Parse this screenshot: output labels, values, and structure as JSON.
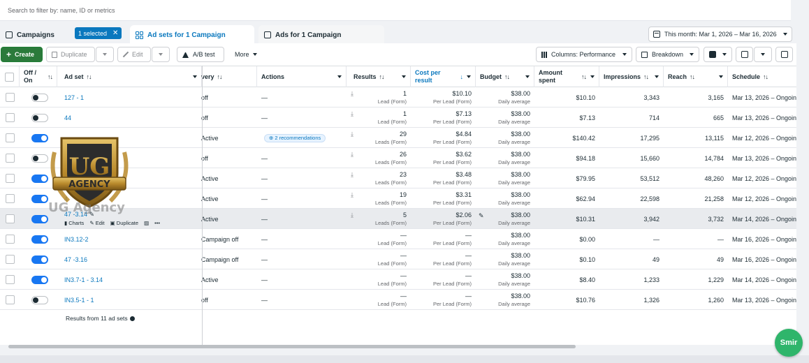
{
  "search": {
    "placeholder": "Search to filter by: name, ID or metrics"
  },
  "tabs": {
    "campaigns": "Campaigns",
    "selected_chip": "1 selected",
    "adsets": "Ad sets for 1 Campaign",
    "ads": "Ads for 1 Campaign"
  },
  "date_range": "This month: Mar 1, 2026 – Mar 16, 2026",
  "toolbar": {
    "create": "Create",
    "duplicate": "Duplicate",
    "edit": "Edit",
    "ab_test": "A/B test",
    "more": "More",
    "columns": "Columns: Performance",
    "breakdown": "Breakdown"
  },
  "headers": {
    "off_on": "Off / On",
    "ad_set": "Ad set",
    "delivery": "very",
    "actions": "Actions",
    "results": "Results",
    "cost_per_result": "Cost per result",
    "budget": "Budget",
    "amount_spent": "Amount spent",
    "impressions": "Impressions",
    "reach": "Reach",
    "schedule": "Schedule"
  },
  "rows": [
    {
      "on": false,
      "name": "127 - 1",
      "delivery": "off",
      "actions": "—",
      "results": "1",
      "results_sub": "Lead (Form)",
      "cost": "$10.10",
      "cost_sub": "Per Lead (Form)",
      "budget": "$38.00",
      "budget_sub": "Daily average",
      "spent": "$10.10",
      "impressions": "3,343",
      "reach": "3,165",
      "schedule": "Mar 13, 2026 – Ongoin"
    },
    {
      "on": false,
      "name": "44",
      "delivery": "off",
      "actions": "—",
      "results": "1",
      "results_sub": "Lead (Form)",
      "cost": "$7.13",
      "cost_sub": "Per Lead (Form)",
      "budget": "$38.00",
      "budget_sub": "Daily average",
      "spent": "$7.13",
      "impressions": "714",
      "reach": "665",
      "schedule": "Mar 13, 2026 – Ongoin"
    },
    {
      "on": true,
      "name": "",
      "delivery": "Active",
      "actions": "2 recommendations",
      "results": "29",
      "results_sub": "Leads (Form)",
      "cost": "$4.84",
      "cost_sub": "Per Lead (Form)",
      "budget": "$38.00",
      "budget_sub": "Daily average",
      "spent": "$140.42",
      "impressions": "17,295",
      "reach": "13,115",
      "schedule": "Mar 12, 2026 – Ongoin"
    },
    {
      "on": false,
      "name": "",
      "delivery": "off",
      "actions": "—",
      "results": "26",
      "results_sub": "Leads (Form)",
      "cost": "$3.62",
      "cost_sub": "Per Lead (Form)",
      "budget": "$38.00",
      "budget_sub": "Daily average",
      "spent": "$94.18",
      "impressions": "15,660",
      "reach": "14,784",
      "schedule": "Mar 13, 2026 – Ongoin"
    },
    {
      "on": true,
      "name": "",
      "delivery": "Active",
      "actions": "—",
      "results": "23",
      "results_sub": "Leads (Form)",
      "cost": "$3.48",
      "cost_sub": "Per Lead (Form)",
      "budget": "$38.00",
      "budget_sub": "Daily average",
      "spent": "$79.95",
      "impressions": "53,512",
      "reach": "48,260",
      "schedule": "Mar 12, 2026 – Ongoin"
    },
    {
      "on": true,
      "name": "4",
      "delivery": "Active",
      "actions": "—",
      "results": "19",
      "results_sub": "Leads (Form)",
      "cost": "$3.31",
      "cost_sub": "Per Lead (Form)",
      "budget": "$38.00",
      "budget_sub": "Daily average",
      "spent": "$62.94",
      "impressions": "22,598",
      "reach": "21,258",
      "schedule": "Mar 12, 2026 – Ongoin"
    },
    {
      "on": true,
      "name": "47 -3.14",
      "delivery": "Active",
      "actions": "—",
      "results": "5",
      "results_sub": "Leads (Form)",
      "cost": "$2.06",
      "cost_sub": "Per Lead (Form)",
      "budget": "$38.00",
      "budget_sub": "Daily average",
      "spent": "$10.31",
      "impressions": "3,942",
      "reach": "3,732",
      "schedule": "Mar 14, 2026 – Ongoin",
      "hover": true
    },
    {
      "on": true,
      "name": "IN3.12-2",
      "delivery": "Campaign off",
      "actions": "—",
      "results": "—",
      "results_sub": "Lead (Form)",
      "cost": "—",
      "cost_sub": "Per Lead (Form)",
      "budget": "$38.00",
      "budget_sub": "Daily average",
      "spent": "$0.00",
      "impressions": "—",
      "reach": "—",
      "schedule": "Mar 16, 2026 – Ongoin"
    },
    {
      "on": true,
      "name": "47 -3.16",
      "delivery": "Campaign off",
      "actions": "—",
      "results": "—",
      "results_sub": "Lead (Form)",
      "cost": "—",
      "cost_sub": "Per Lead (Form)",
      "budget": "$38.00",
      "budget_sub": "Daily average",
      "spent": "$0.10",
      "impressions": "49",
      "reach": "49",
      "schedule": "Mar 16, 2026 – Ongoin"
    },
    {
      "on": true,
      "name": "IN3.7-1 - 3.14",
      "delivery": "Active",
      "actions": "—",
      "results": "—",
      "results_sub": "Lead (Form)",
      "cost": "—",
      "cost_sub": "Per Lead (Form)",
      "budget": "$38.00",
      "budget_sub": "Daily average",
      "spent": "$8.40",
      "impressions": "1,233",
      "reach": "1,229",
      "schedule": "Mar 14, 2026 – Ongoin"
    },
    {
      "on": false,
      "name": "IN3.5-1 - 1",
      "delivery": "off",
      "actions": "—",
      "results": "—",
      "results_sub": "Lead (Form)",
      "cost": "—",
      "cost_sub": "Per Lead (Form)",
      "budget": "$38.00",
      "budget_sub": "Daily average",
      "spent": "$10.76",
      "impressions": "1,326",
      "reach": "1,260",
      "schedule": "Mar 13, 2026 – Ongoin"
    }
  ],
  "hover_actions": {
    "charts": "Charts",
    "edit": "Edit",
    "duplicate": "Duplicate",
    "more": "•••"
  },
  "footer": "Results from 11 ad sets",
  "watermark": {
    "badge_top": "UG",
    "badge_band": "AGENCY",
    "text": "UG Agency"
  },
  "fab_label": "Smir",
  "colors": {
    "accent": "#0a78be",
    "create_green": "#2b7a3b",
    "toggle_on": "#1877f2"
  }
}
